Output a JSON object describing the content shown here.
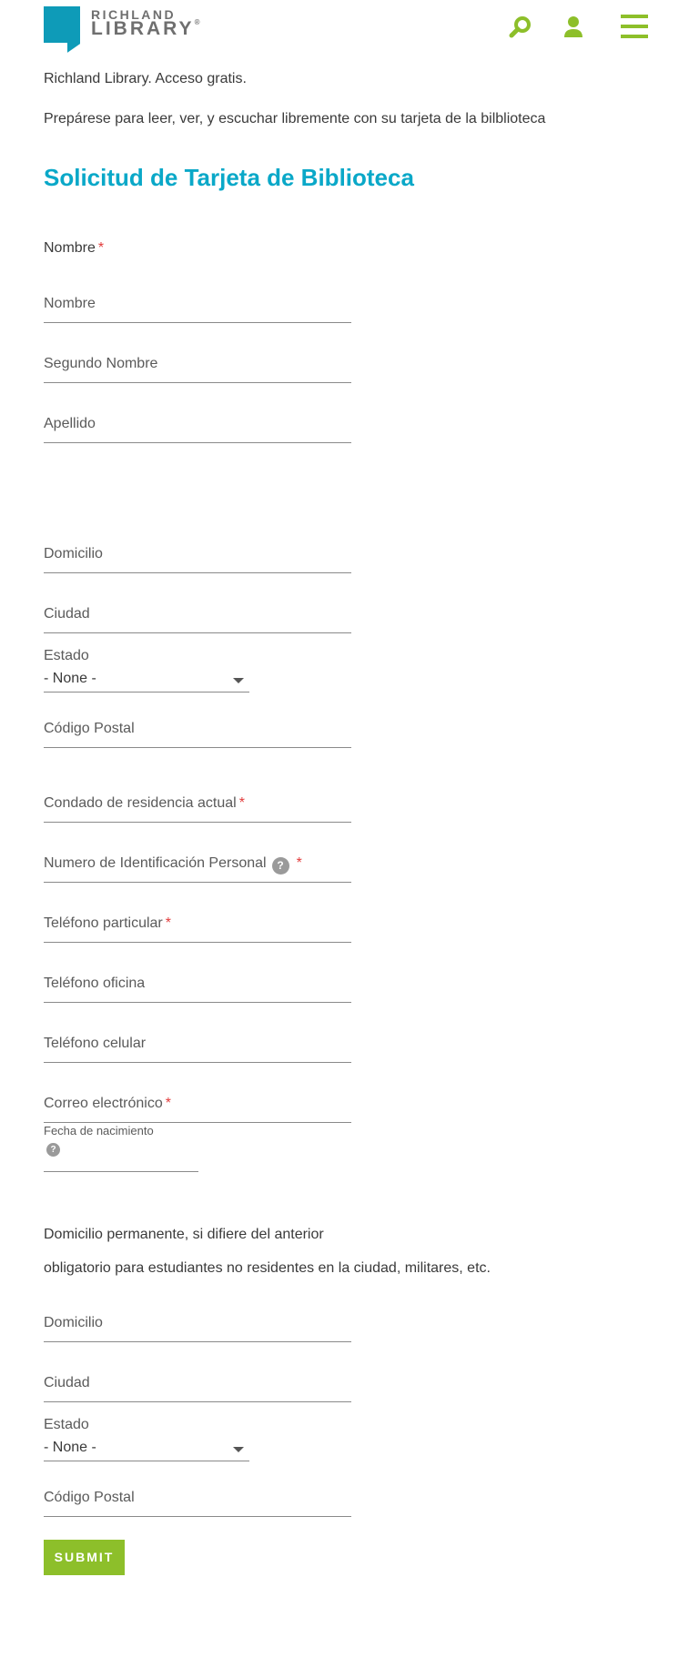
{
  "header": {
    "logo_line1": "RICHLAND",
    "logo_line2": "LIBRARY",
    "logo_reg": "®"
  },
  "intro": {
    "line1": "Richland Library. Acceso gratis.",
    "line2": "Prepárese para leer, ver, y escuchar libremente con su tarjeta de la bilblioteca"
  },
  "form": {
    "title": "Solicitud de Tarjeta de Biblioteca",
    "nombre_section": "Nombre",
    "required_mark": "*",
    "help_glyph": "?",
    "fields": {
      "first_name": "Nombre",
      "middle_name": "Segundo Nombre",
      "last_name": "Apellido",
      "address": "Domicilio",
      "city": "Ciudad",
      "state_label": "Estado",
      "state_value": "- None -",
      "zip": "Código Postal",
      "county": "Condado de residencia actual",
      "pin": "Numero de Identificación Personal",
      "home_phone": "Teléfono particular",
      "work_phone": "Teléfono oficina",
      "cell_phone": "Teléfono celular",
      "email": "Correo electrónico",
      "birth_date": "Fecha de nacimiento"
    },
    "permanent": {
      "heading": "Domicilio permanente, si difiere del anterior",
      "note": "obligatorio para estudiantes no residentes en la ciudad, militares, etc.",
      "address": "Domicilio",
      "city": "Ciudad",
      "state_label": "Estado",
      "state_value": "- None -",
      "zip": "Código Postal"
    },
    "submit_label": "SUBMIT"
  },
  "colors": {
    "brand_blue": "#0aa8c8",
    "accent_green": "#8dbf2a",
    "required_red": "#e23b3b"
  },
  "icons": [
    "search-icon",
    "user-icon",
    "menu-icon",
    "help-icon",
    "chevron-down-icon"
  ]
}
